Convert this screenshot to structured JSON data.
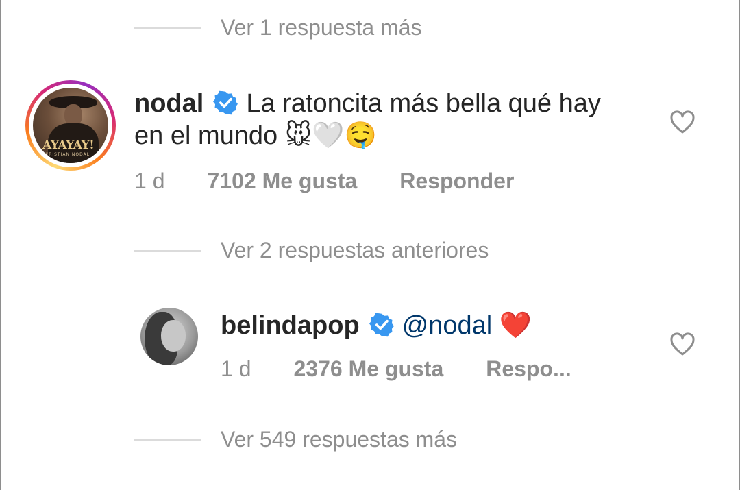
{
  "thread": {
    "more_top": "Ver 1 respuesta más",
    "more_mid": "Ver 2 respuestas anteriores",
    "more_bottom": "Ver 549 respuestas más"
  },
  "comments": [
    {
      "username": "nodal",
      "text_line1": "La ratoncita más bella qué hay",
      "text_line2": "en el mundo",
      "emojis": "🐭🤍🤤",
      "avatar_logo": "AYAYAY!",
      "avatar_logo_sub": "CRISTIAN NODAL",
      "time": "1 d",
      "likes": "7102 Me gusta",
      "reply": "Responder"
    },
    {
      "username": "belindapop",
      "mention": "@nodal",
      "emojis": "❤️",
      "time": "1 d",
      "likes": "2376 Me gusta",
      "reply": "Respo..."
    }
  ],
  "icons": {
    "verified": "verified-badge-icon",
    "like": "heart-outline-icon"
  },
  "colors": {
    "verified_blue": "#3897f0",
    "mention": "#00376b",
    "muted": "#8e8e8e"
  }
}
